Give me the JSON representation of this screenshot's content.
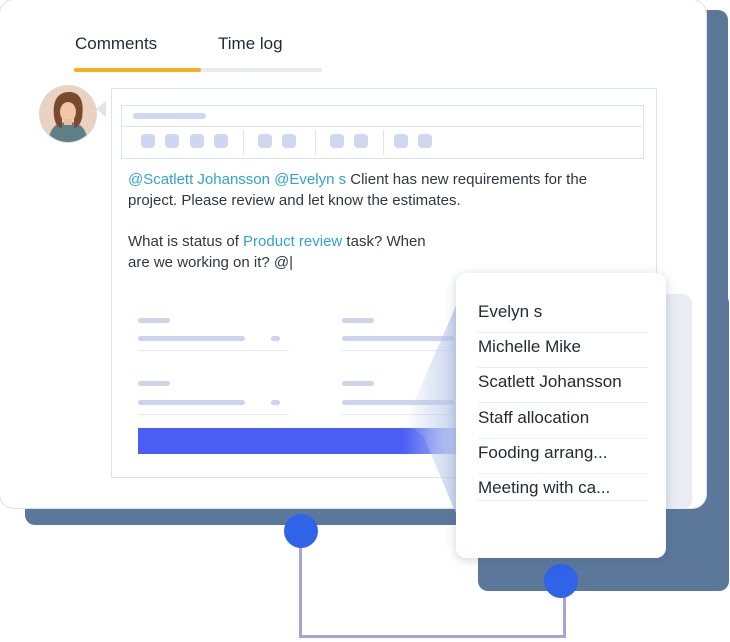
{
  "tabs": [
    {
      "label": "Comments",
      "active": true
    },
    {
      "label": "Time log",
      "active": false
    }
  ],
  "comment": {
    "line1": {
      "mention1": "@Scatlett Johansson",
      "mention2": "@Evelyn s",
      "text": " Client has new requirements for the"
    },
    "line2": "project. Please review and let know the estimates.",
    "line3": {
      "prefix": "What is status of ",
      "link": "Product review",
      "suffix": " task? When"
    },
    "line4": "are we working on it? @|"
  },
  "mention_dropdown": {
    "items": [
      "Evelyn s",
      "Michelle Mike",
      "Scatlett Johansson",
      "Staff allocation",
      "Fooding arrang...",
      "Meeting with ca..."
    ]
  },
  "colors": {
    "accent_tab": "#f3b21b",
    "mention": "#2fa4cc",
    "primary_bar": "#4b5df2",
    "back_card": "#5b789b",
    "connector": "#2f63e8"
  }
}
